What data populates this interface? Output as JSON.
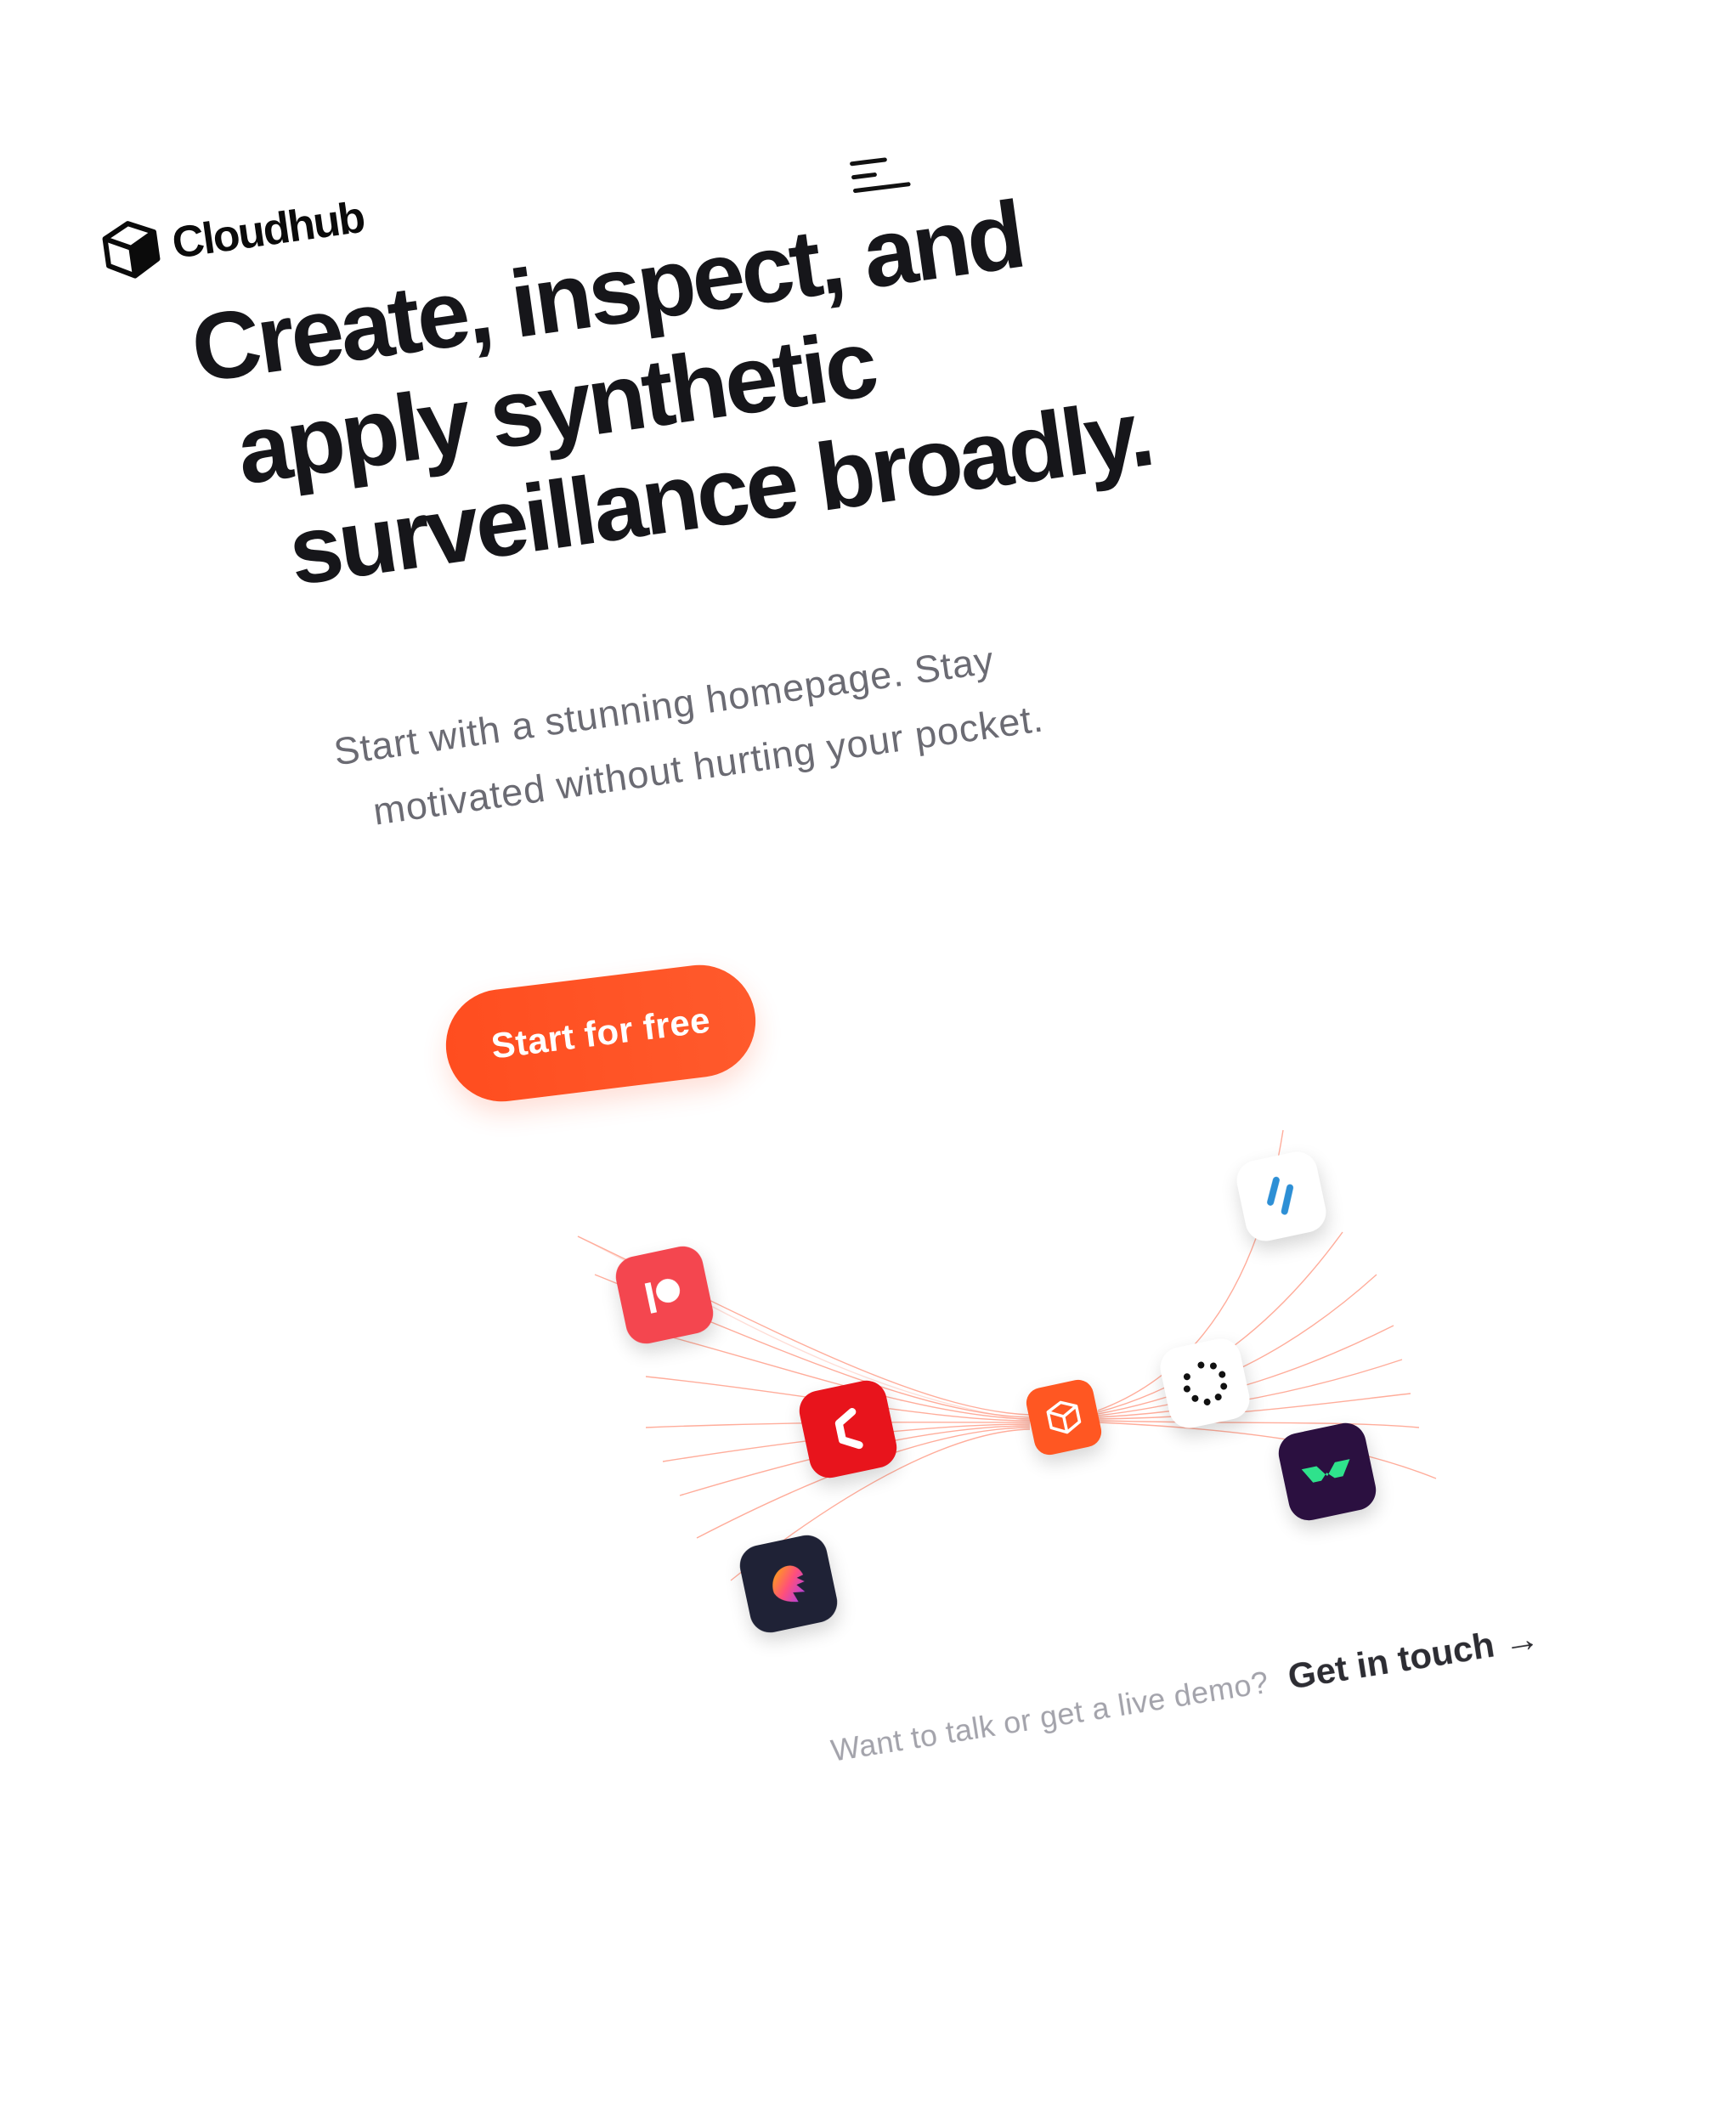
{
  "brand": {
    "name": "Cloudhub",
    "logo_icon": "cube-icon"
  },
  "nav": {
    "menu_icon": "menu-icon"
  },
  "hero": {
    "headline_lines": [
      "Create, inspect, and",
      "apply synthetic",
      "surveillance broadly."
    ],
    "subtext_lines": [
      "Start with a stunning homepage. Stay",
      "motivated without hurting your pocket."
    ],
    "cta_label": "Start for free"
  },
  "integrations": {
    "icons": [
      "patreon-icon",
      "craft-icon",
      "cloudhub-cube-icon",
      "dots-ring-icon",
      "stripes-icon",
      "twist-icon",
      "lion-icon"
    ]
  },
  "footer": {
    "question": "Want to talk or get a live demo?",
    "link_label": "Get in touch",
    "link_arrow": "→"
  },
  "colors": {
    "accent": "#ff4d1f",
    "text_dark": "#16161a",
    "text_muted": "#6b6b73",
    "text_faint": "#a3a3ab"
  }
}
